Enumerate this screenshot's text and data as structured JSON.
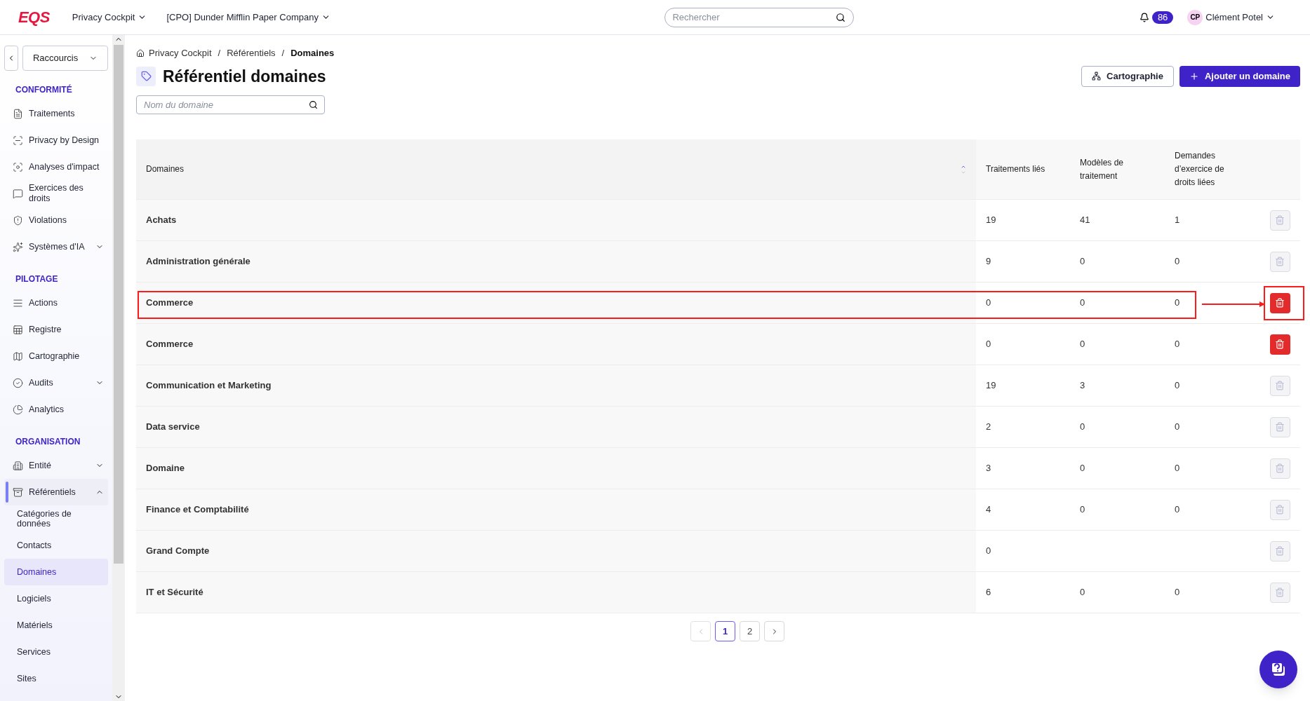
{
  "topbar": {
    "logo": "EQS",
    "app_menu": "Privacy Cockpit",
    "company_menu": "[CPO] Dunder Mifflin Paper Company",
    "search": {
      "placeholder": "Rechercher"
    },
    "notifications": "86",
    "user": {
      "initials": "CP",
      "name": "Clément Potel"
    }
  },
  "sidebar": {
    "shortcuts": "Raccourcis",
    "sections": [
      {
        "title": "CONFORMITÉ",
        "items": [
          {
            "label": "Traitements",
            "selected": false
          },
          {
            "label": "Privacy by Design",
            "selected": false
          },
          {
            "label": "Analyses d'impact",
            "selected": false
          },
          {
            "label": "Exercices des droits",
            "selected": false
          },
          {
            "label": "Violations",
            "selected": false
          },
          {
            "label": "Systèmes d'IA",
            "selected": false,
            "expanded": false
          }
        ]
      },
      {
        "title": "PILOTAGE",
        "items": [
          {
            "label": "Actions",
            "selected": false
          },
          {
            "label": "Registre",
            "selected": false
          },
          {
            "label": "Cartographie",
            "selected": false
          },
          {
            "label": "Audits",
            "selected": false,
            "expanded": false
          },
          {
            "label": "Analytics",
            "selected": false
          }
        ]
      },
      {
        "title": "ORGANISATION",
        "items": [
          {
            "label": "Entité",
            "selected": false,
            "expanded": false
          },
          {
            "label": "Référentiels",
            "selected": true,
            "expanded": true,
            "children": [
              {
                "label": "Catégories de données",
                "selected": false
              },
              {
                "label": "Contacts",
                "selected": false
              },
              {
                "label": "Domaines",
                "selected": true
              },
              {
                "label": "Logiciels",
                "selected": false
              },
              {
                "label": "Matériels",
                "selected": false
              },
              {
                "label": "Services",
                "selected": false
              },
              {
                "label": "Sites",
                "selected": false
              }
            ]
          }
        ]
      }
    ]
  },
  "breadcrumb": [
    {
      "kind": "link",
      "label": "Privacy Cockpit"
    },
    {
      "kind": "separator",
      "label": "/"
    },
    {
      "kind": "link",
      "label": "Référentiels"
    },
    {
      "kind": "separator",
      "label": "/"
    },
    {
      "kind": "current",
      "label": "Domaines"
    }
  ],
  "title": "Référentiel domaines",
  "actions": {
    "secondary": "Cartographie",
    "primary": "Ajouter un domaine"
  },
  "filter": {
    "placeholder": "Nom du domaine"
  },
  "table": {
    "columns": [
      "Domaines",
      "Traitements liés",
      "Modèles de traitement",
      "Demandes d’exercice de droits liées"
    ],
    "rows": [
      {
        "domain": "Achats",
        "processing": "19",
        "models": "41",
        "requests": "1",
        "deletable": false,
        "highlighted": false
      },
      {
        "domain": "Administration générale",
        "processing": "9",
        "models": "0",
        "requests": "0",
        "deletable": false,
        "highlighted": false
      },
      {
        "domain": "Commerce",
        "processing": "0",
        "models": "0",
        "requests": "0",
        "deletable": true,
        "highlighted": true
      },
      {
        "domain": "Commerce",
        "processing": "0",
        "models": "0",
        "requests": "0",
        "deletable": true,
        "highlighted": false
      },
      {
        "domain": "Communication et Marketing",
        "processing": "19",
        "models": "3",
        "requests": "0",
        "deletable": false,
        "highlighted": false
      },
      {
        "domain": "Data service",
        "processing": "2",
        "models": "0",
        "requests": "0",
        "deletable": false,
        "highlighted": false
      },
      {
        "domain": "Domaine",
        "processing": "3",
        "models": "0",
        "requests": "0",
        "deletable": false,
        "highlighted": false
      },
      {
        "domain": "Finance et Comptabilité",
        "processing": "4",
        "models": "0",
        "requests": "0",
        "deletable": false,
        "highlighted": false
      },
      {
        "domain": "Grand Compte",
        "processing": "0",
        "deletable": false,
        "highlighted": false
      },
      {
        "domain": "IT et Sécurité",
        "processing": "6",
        "models": "0",
        "requests": "0",
        "deletable": false,
        "highlighted": false
      }
    ]
  },
  "pagination": {
    "prev_disabled": true,
    "pages": [
      {
        "label": "1",
        "selected": true
      },
      {
        "label": "2",
        "selected": false
      }
    ]
  }
}
